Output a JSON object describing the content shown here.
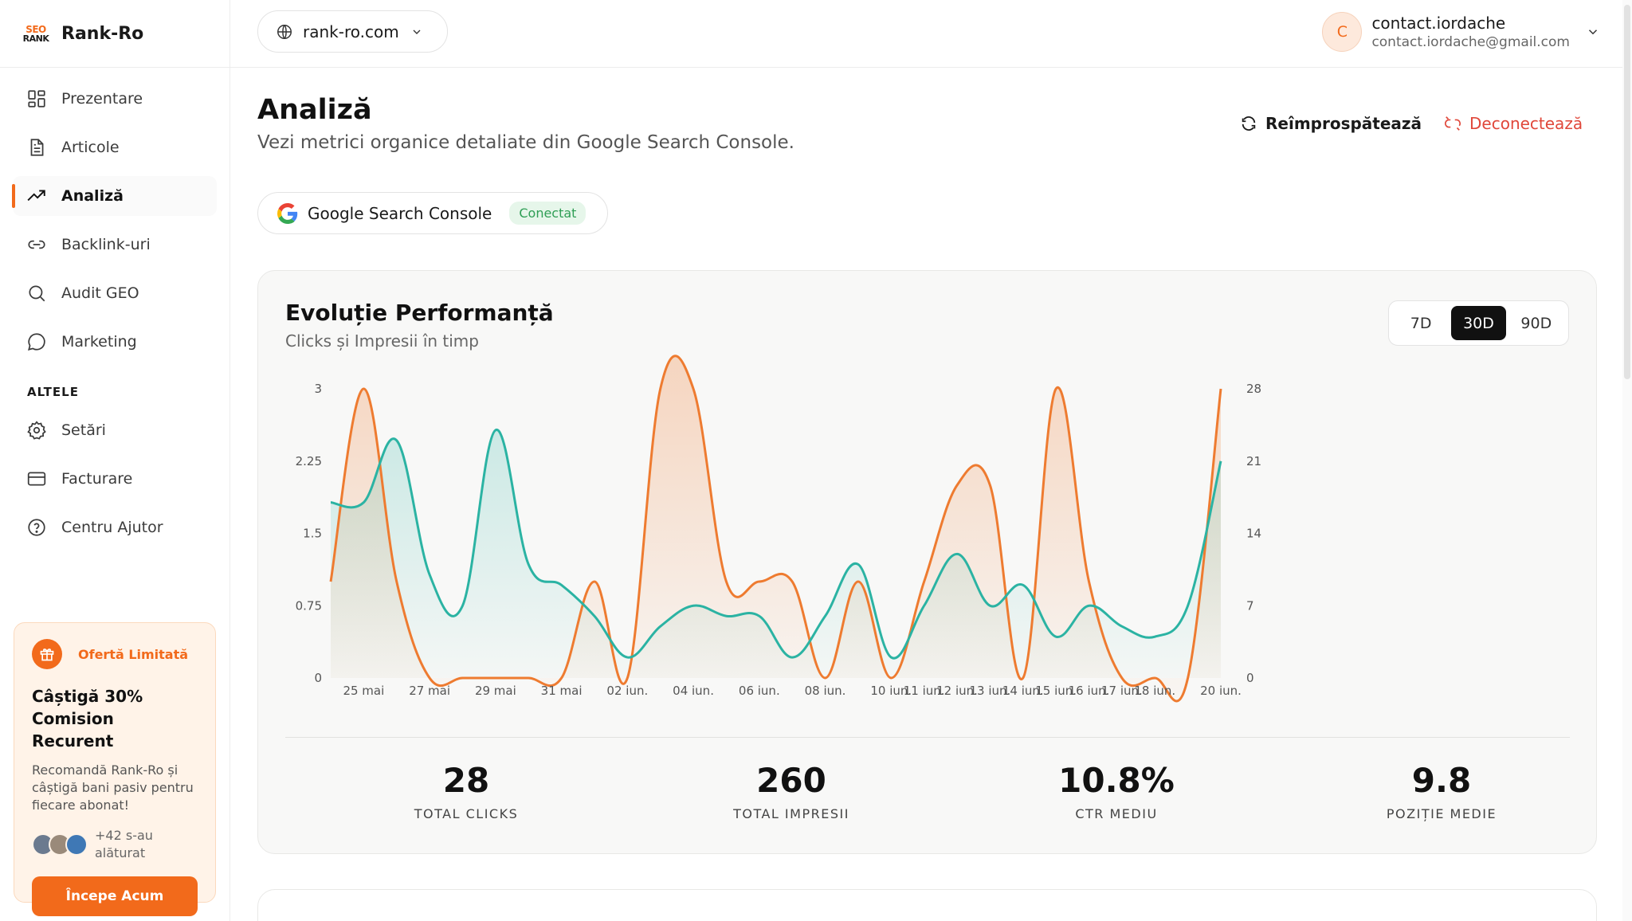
{
  "brand": {
    "logo_line1": "SEO",
    "logo_line2": "RANK",
    "name": "Rank-Ro",
    "accent": "#f26a1b"
  },
  "sidebar": {
    "items": [
      {
        "label": "Prezentare",
        "icon": "grid-icon"
      },
      {
        "label": "Articole",
        "icon": "document-icon"
      },
      {
        "label": "Analiză",
        "icon": "trending-up-icon",
        "active": true
      },
      {
        "label": "Backlink-uri",
        "icon": "link-icon"
      },
      {
        "label": "Audit GEO",
        "icon": "search-icon"
      },
      {
        "label": "Marketing",
        "icon": "chat-icon"
      }
    ],
    "section_label": "ALTELE",
    "other_items": [
      {
        "label": "Setări",
        "icon": "gear-icon"
      },
      {
        "label": "Facturare",
        "icon": "credit-card-icon"
      },
      {
        "label": "Centru Ajutor",
        "icon": "help-icon"
      }
    ]
  },
  "promo": {
    "tag": "Ofertă Limitată",
    "title": "Câștigă 30% Comision Recurent",
    "description": "Recomandă Rank-Ro și câștigă bani pasiv pentru fiecare abonat!",
    "joined": "+42 s-au alăturat",
    "button": "Începe Acum"
  },
  "header": {
    "site": "rank-ro.com",
    "user_initial": "C",
    "user_name": "contact.iordache",
    "user_email": "contact.iordache@gmail.com"
  },
  "page": {
    "title": "Analiză",
    "subtitle": "Vezi metrici organice detaliate din Google Search Console.",
    "refresh_label": "Reîmprospătează",
    "disconnect_label": "Deconectează",
    "integration_label": "Google Search Console",
    "integration_status": "Conectat"
  },
  "card": {
    "title": "Evoluție Performanță",
    "subtitle": "Clicks și Impresii în timp",
    "ranges": [
      "7D",
      "30D",
      "90D"
    ],
    "active_range": "30D"
  },
  "chart_data": {
    "type": "line",
    "x": [
      "24 mai",
      "25 mai",
      "26 mai",
      "27 mai",
      "28 mai",
      "29 mai",
      "30 mai",
      "31 mai",
      "01 iun.",
      "02 iun.",
      "03 iun.",
      "04 iun.",
      "05 iun.",
      "06 iun.",
      "07 iun.",
      "08 iun.",
      "09 iun.",
      "10 iun.",
      "11 iun.",
      "12 iun.",
      "13 iun.",
      "14 iun.",
      "15 iun.",
      "16 iun.",
      "17 iun.",
      "18 iun.",
      "19 iun.",
      "20 iun."
    ],
    "x_tick_labels": [
      "25 mai",
      "27 mai",
      "29 mai",
      "31 mai",
      "02 iun.",
      "04 iun.",
      "06 iun.",
      "08 iun.",
      "10 iun.",
      "11 iun.",
      "12 iun.",
      "13 iun.",
      "14 iun.",
      "15 iun.",
      "16 iun.",
      "17 iun.",
      "18 iun.",
      "20 iun."
    ],
    "series": [
      {
        "values": [
          1,
          3,
          1,
          0,
          0,
          0,
          0,
          0,
          1,
          0,
          3,
          3,
          1,
          1,
          1,
          0,
          1,
          0,
          1,
          2,
          2,
          0,
          3,
          1,
          0,
          0,
          0,
          3
        ],
        "axis": "left",
        "color": "#ee7b30"
      },
      {
        "values": [
          17,
          17,
          23,
          10,
          7,
          24,
          11,
          9,
          6,
          2,
          5,
          7,
          6,
          6,
          2,
          6,
          11,
          2,
          7,
          12,
          7,
          9,
          4,
          7,
          5,
          4,
          7,
          21
        ],
        "axis": "right",
        "color": "#2bb3a3"
      }
    ],
    "ylim_left": [
      0,
      3
    ],
    "yticks_left": [
      "0",
      "0.75",
      "1.5",
      "2.25",
      "3"
    ],
    "ylim_right": [
      0,
      28
    ],
    "yticks_right": [
      "0",
      "7",
      "14",
      "21",
      "28"
    ],
    "grid": false
  },
  "stats": [
    {
      "value": "28",
      "label": "TOTAL CLICKS"
    },
    {
      "value": "260",
      "label": "TOTAL IMPRESII"
    },
    {
      "value": "10.8%",
      "label": "CTR MEDIU"
    },
    {
      "value": "9.8",
      "label": "POZIȚIE MEDIE"
    }
  ]
}
